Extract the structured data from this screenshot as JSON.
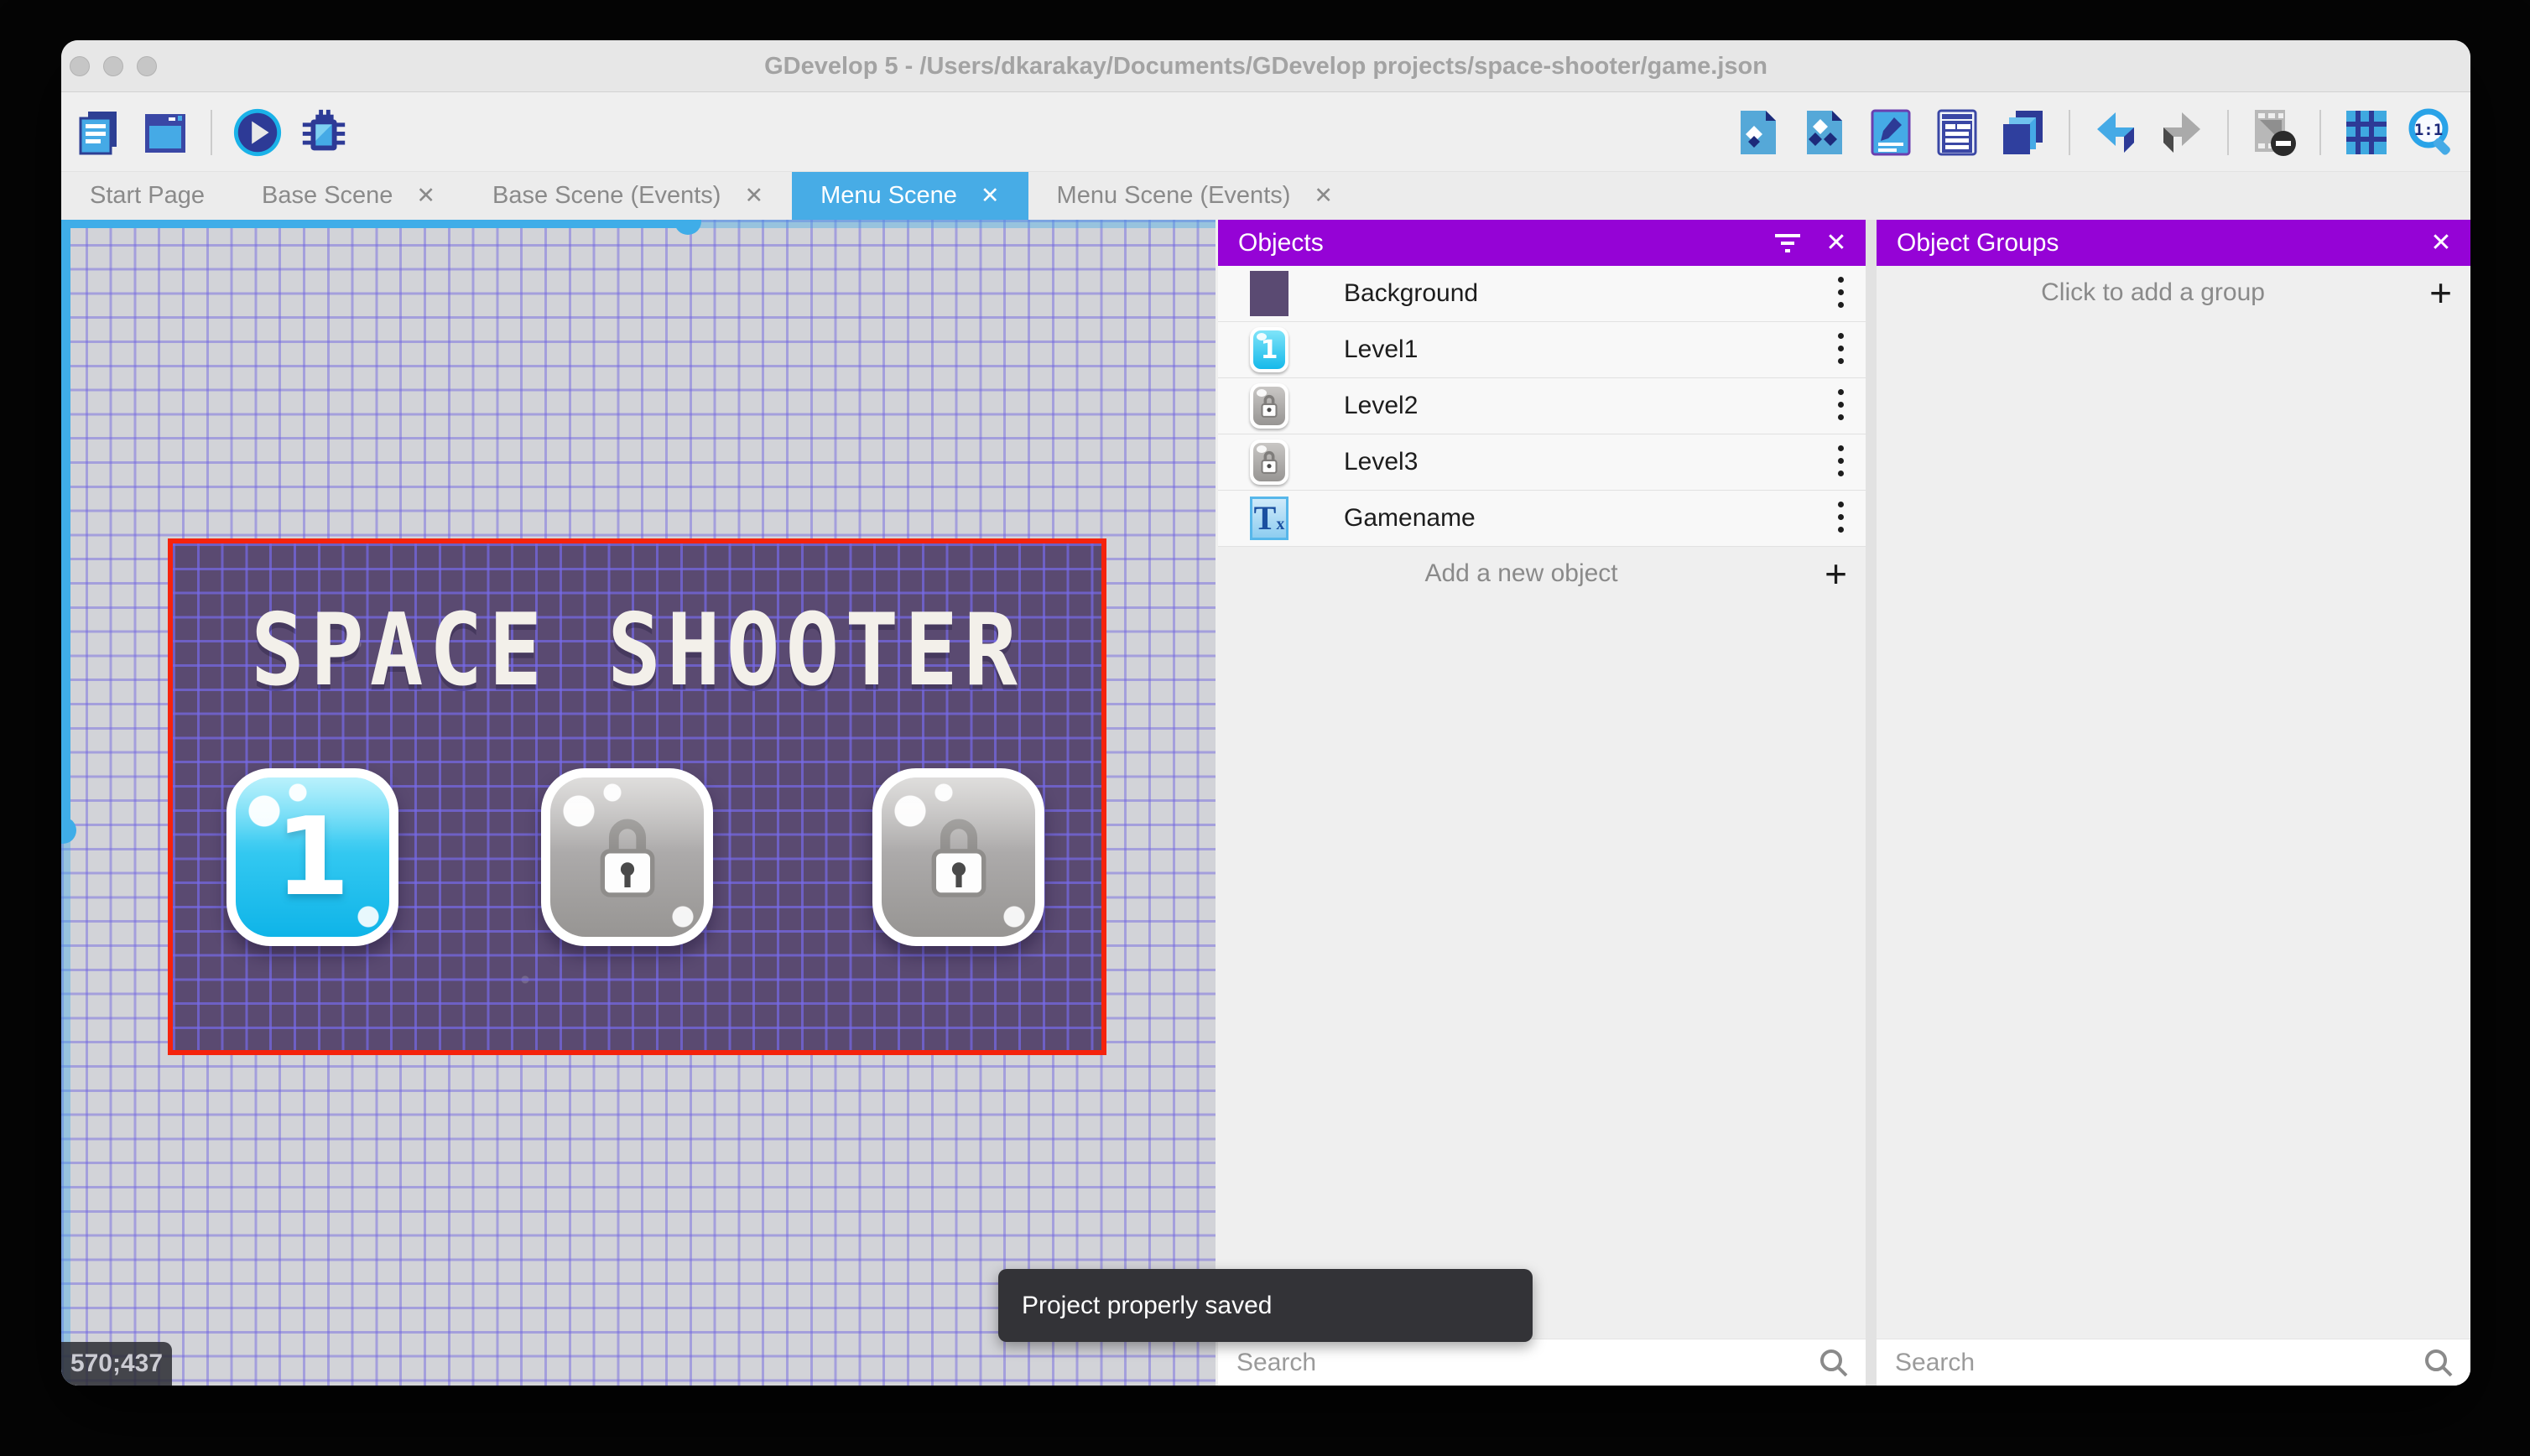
{
  "window": {
    "title": "GDevelop 5 - /Users/dkarakay/Documents/GDevelop projects/space-shooter/game.json"
  },
  "glyphs": {
    "close": "✕",
    "plus": "+",
    "text_object_T": "T",
    "text_object_x": "x"
  },
  "toolbar": {
    "zoom_label": "1:1",
    "left_icons": [
      "project-manager-icon",
      "scene-window-icon",
      "play-icon",
      "debug-icon"
    ],
    "right_icons": [
      "objects-list-icon",
      "object-groups-icon",
      "properties-icon",
      "instances-list-icon",
      "layers-icon",
      "undo-icon",
      "redo-icon",
      "window-mask-icon",
      "grid-icon",
      "zoom-1-1-icon"
    ]
  },
  "tabs": [
    {
      "label": "Start Page",
      "closable": false,
      "active": false
    },
    {
      "label": "Base Scene",
      "closable": true,
      "active": false
    },
    {
      "label": "Base Scene (Events)",
      "closable": true,
      "active": false
    },
    {
      "label": "Menu Scene",
      "closable": true,
      "active": true
    },
    {
      "label": "Menu Scene (Events)",
      "closable": true,
      "active": false
    }
  ],
  "scene": {
    "title_text": "SPACE SHOOTER",
    "level1_label": "1",
    "coordinates": "570;437"
  },
  "objects_panel": {
    "title": "Objects",
    "items": [
      {
        "label": "Background",
        "thumb": "purple-rect"
      },
      {
        "label": "Level1",
        "thumb": "blue-button-1"
      },
      {
        "label": "Level2",
        "thumb": "locked-button"
      },
      {
        "label": "Level3",
        "thumb": "locked-button"
      },
      {
        "label": "Gamename",
        "thumb": "text-object"
      }
    ],
    "add_label": "Add a new object",
    "search_placeholder": "Search"
  },
  "object_groups_panel": {
    "title": "Object Groups",
    "empty_label": "Click to add a group",
    "search_placeholder": "Search"
  },
  "toast": {
    "message": "Project properly saved"
  },
  "colors": {
    "accent_purple": "#9503d6",
    "active_tab_blue": "#47ace6",
    "selection_red": "#f5230c",
    "scene_background": "#5a4a71",
    "scrollbar_blue": "#3fade8"
  }
}
